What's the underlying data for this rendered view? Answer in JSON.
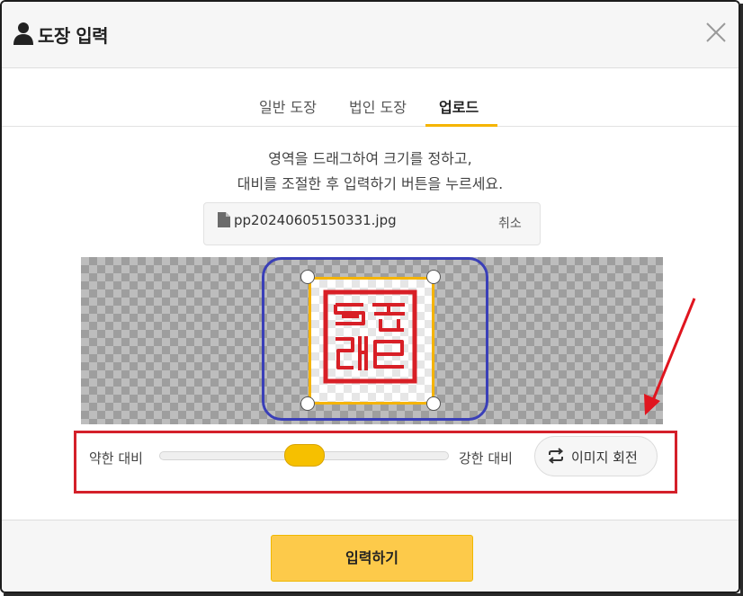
{
  "header": {
    "title": "도장 입력",
    "user_icon": "user-icon",
    "close_icon": "close-icon"
  },
  "tabs": [
    {
      "label": "일반 도장",
      "active": false
    },
    {
      "label": "법인 도장",
      "active": false
    },
    {
      "label": "업로드",
      "active": true
    }
  ],
  "instructions": {
    "line1": "영역을 드래그하여 크기를 정하고,",
    "line2": "대비를 조절한 후 입력하기 버튼을 누르세요."
  },
  "file": {
    "icon": "file-icon",
    "name": "pp20240605150331.jpg",
    "cancel_label": "취소"
  },
  "contrast": {
    "weak_label": "약한 대비",
    "strong_label": "강한 대비",
    "value_fraction": 0.46
  },
  "rotate_button": {
    "icon": "rotate-icon",
    "label": "이미지 회전"
  },
  "submit_label": "입력하기",
  "colors": {
    "accent": "#f5b400",
    "button": "#fdca4a",
    "stamp_red": "#d81f26",
    "annotation_blue": "#3a3fb8",
    "annotation_red": "#d4202a"
  }
}
